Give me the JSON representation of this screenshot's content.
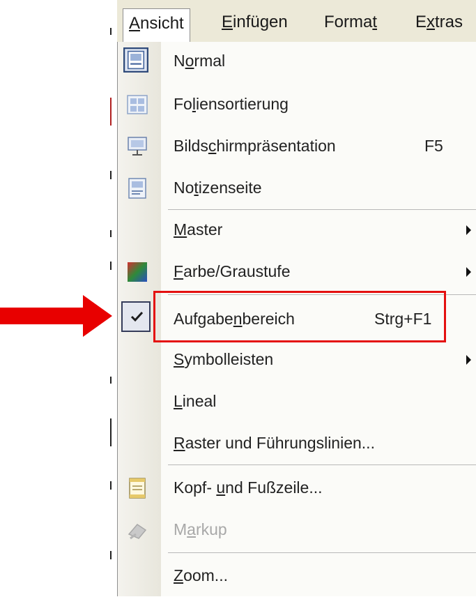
{
  "menubar": {
    "items": [
      {
        "pre": "",
        "u": "A",
        "post": "nsicht"
      },
      {
        "pre": "",
        "u": "E",
        "post": "infügen"
      },
      {
        "pre": "Forma",
        "u": "t",
        "post": ""
      },
      {
        "pre": "E",
        "u": "x",
        "post": "tras"
      }
    ]
  },
  "menu": {
    "items": [
      {
        "pre": "N",
        "u": "o",
        "post": "rmal",
        "icon": "normal-view-icon"
      },
      {
        "pre": "Fo",
        "u": "l",
        "post": "iensortierung",
        "icon": "slide-sorter-icon"
      },
      {
        "pre": "Bilds",
        "u": "c",
        "post": "hirmpräsentation",
        "shortcut": "F5",
        "icon": "slideshow-icon"
      },
      {
        "pre": "No",
        "u": "t",
        "post": "izenseite",
        "icon": "notes-page-icon"
      },
      {
        "pre": "",
        "u": "M",
        "post": "aster",
        "submenu": true
      },
      {
        "pre": "",
        "u": "F",
        "post": "arbe/Graustufe",
        "submenu": true,
        "icon": "color-grayscale-icon"
      },
      {
        "pre": "Aufgabe",
        "u": "n",
        "post": "bereich",
        "shortcut": "Strg+F1",
        "checked": true,
        "icon": "checkmark-icon"
      },
      {
        "pre": "",
        "u": "S",
        "post": "ymbolleisten",
        "submenu": true
      },
      {
        "pre": "",
        "u": "L",
        "post": "ineal"
      },
      {
        "pre": "",
        "u": "R",
        "post": "aster und Führungslinien..."
      },
      {
        "pre": "Kopf- ",
        "u": "u",
        "post": "nd Fußzeile...",
        "icon": "header-footer-icon"
      },
      {
        "pre": "M",
        "u": "a",
        "post": "rkup",
        "disabled": true,
        "icon": "markup-icon"
      },
      {
        "pre": "",
        "u": "Z",
        "post": "oom..."
      }
    ]
  },
  "colors": {
    "annotation": "#e41010",
    "menubar_bg": "#ece9d8",
    "menu_bg": "#fbfbf8",
    "checkbox_border": "#353c5a"
  }
}
